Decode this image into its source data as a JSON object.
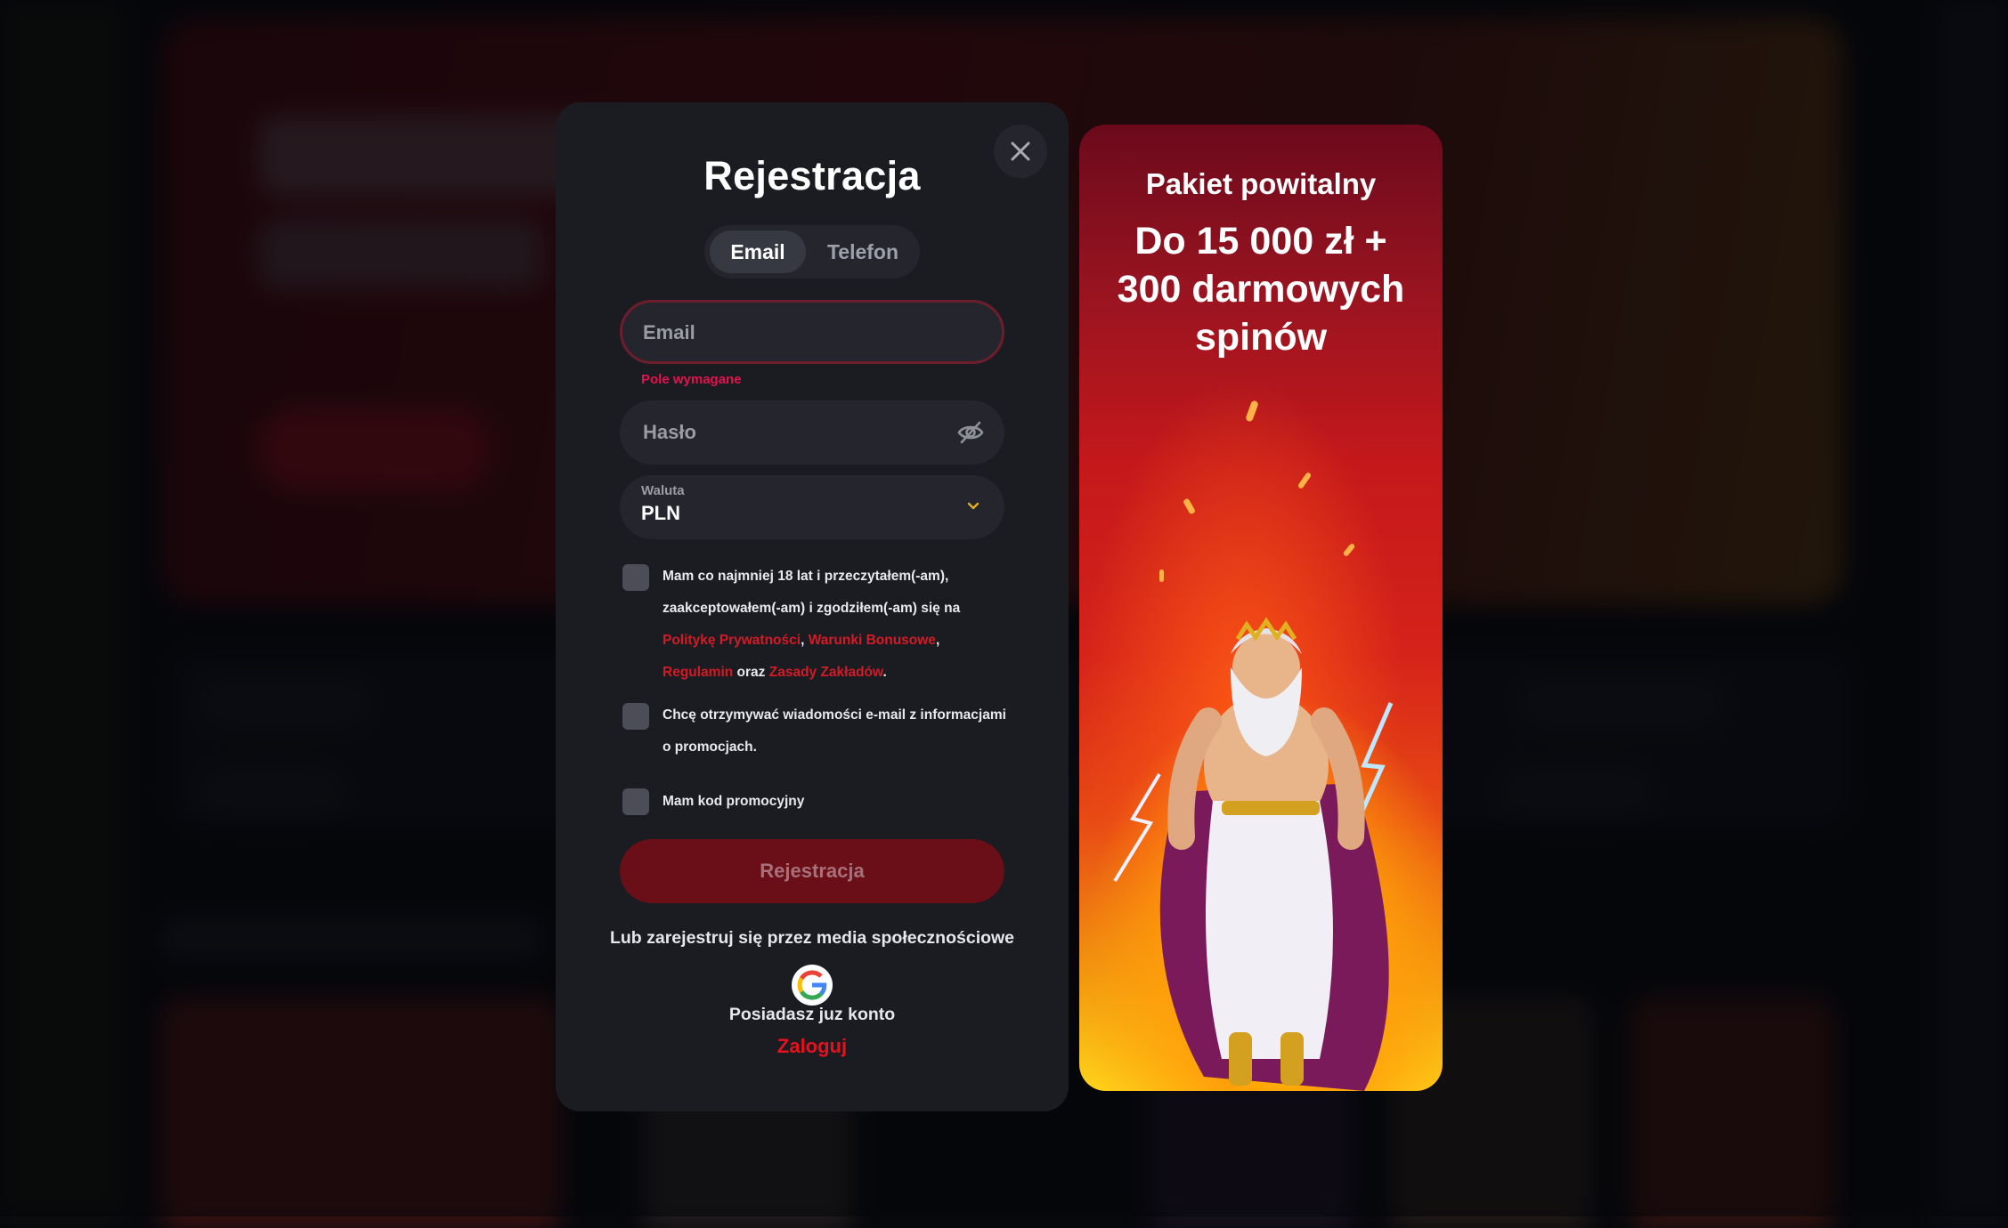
{
  "modal": {
    "title": "Rejestracja",
    "tabs": [
      {
        "label": "Email",
        "active": true
      },
      {
        "label": "Telefon",
        "active": false
      }
    ],
    "email": {
      "placeholder": "Email",
      "value": "",
      "error": "Pole wymagane"
    },
    "password": {
      "placeholder": "Hasło",
      "value": ""
    },
    "currency": {
      "label": "Waluta",
      "value": "PLN"
    },
    "checkboxes": {
      "terms": {
        "checked": false,
        "line1": "Mam co najmniej 18 lat i przeczytałem(-am),",
        "line2": "zaakceptowałem(-am) i zgodziłem(-am) się na",
        "privacy_link": "Politykę Prywatności",
        "comma1": ",",
        "bonus_link": "Warunki Bonusowe",
        "comma2": ",",
        "rules_link": "Regulamin",
        "and": "oraz",
        "betting_link": "Zasady Zakładów",
        "period": "."
      },
      "newsletter": {
        "checked": false,
        "line1": "Chcę otrzymywać wiadomości e-mail z informacjami",
        "line2": "o promocjach."
      },
      "promo_code": {
        "checked": false,
        "label": "Mam kod promocyjny"
      }
    },
    "submit_label": "Rejestracja",
    "social_text": "Lub zarejestruj się przez media społecznościowe",
    "have_account": "Posiadasz juz konto",
    "login_label": "Zaloguj"
  },
  "promo": {
    "subtitle": "Pakiet powitalny",
    "headline_lines": [
      "Do 15 000 zł +",
      "300 darmowych",
      "spinów"
    ]
  },
  "colors": {
    "accent_red": "#d31b26",
    "error": "#e3134e",
    "modal_bg": "#1b1c22",
    "field_bg": "#25262d"
  },
  "icons": [
    "close-icon",
    "eye-off-icon",
    "chevron-down-icon",
    "google-icon"
  ]
}
